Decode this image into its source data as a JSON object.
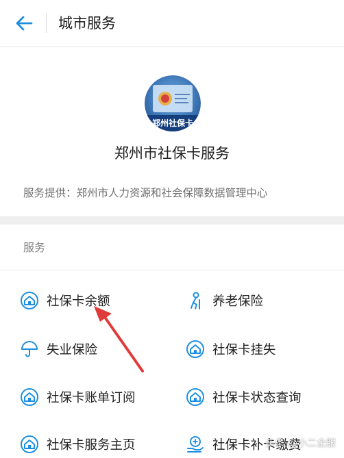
{
  "header": {
    "title": "城市服务"
  },
  "service": {
    "logo_caption": "郑州社保卡",
    "name": "郑州市社保卡服务",
    "provider": "服务提供：郑州市人力资源和社会保障数据管理中心"
  },
  "section": {
    "title": "服务"
  },
  "services": [
    {
      "label": "社保卡余额",
      "icon": "house-circle-icon"
    },
    {
      "label": "养老保险",
      "icon": "elderly-person-icon"
    },
    {
      "label": "失业保险",
      "icon": "umbrella-icon"
    },
    {
      "label": "社保卡挂失",
      "icon": "house-circle-icon"
    },
    {
      "label": "社保卡账单订阅",
      "icon": "house-circle-icon"
    },
    {
      "label": "社保卡状态查询",
      "icon": "house-circle-icon"
    },
    {
      "label": "社保卡服务主页",
      "icon": "house-circle-icon"
    },
    {
      "label": "社保卡补卡缴费",
      "icon": "hand-coin-icon"
    }
  ],
  "watermark": "头条 @小二企服",
  "colors": {
    "accent": "#1e8fe0",
    "annotation_arrow": "#e03b3b"
  }
}
